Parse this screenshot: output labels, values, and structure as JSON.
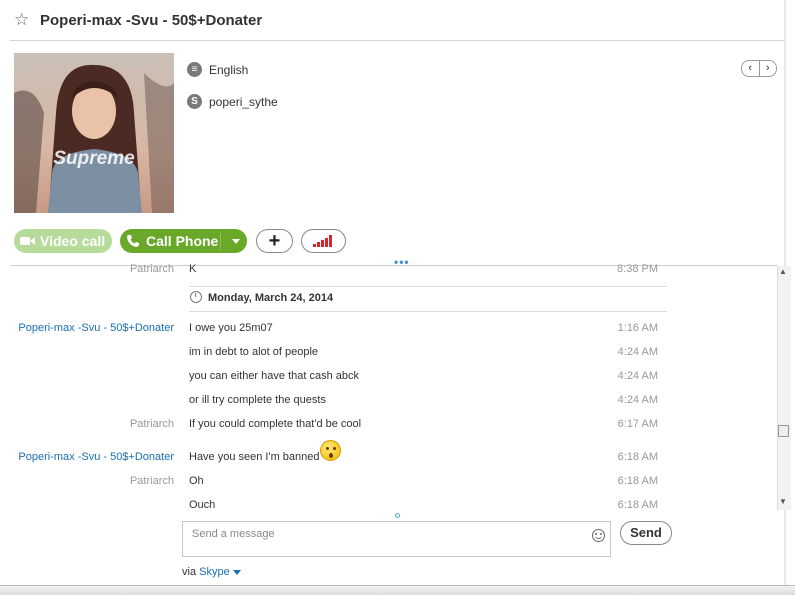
{
  "contact": {
    "name": "Poperi-max -Svu - 50$+Donater",
    "language": "English",
    "skype_name": "poperi_sythe",
    "avatar_text": "Supreme"
  },
  "icons": {
    "favorite": "star-icon",
    "language": "speech-bubble-icon",
    "skype": "skype-icon",
    "video": "video-camera-icon",
    "phone": "phone-icon",
    "add": "plus-icon",
    "signal": "signal-bars-icon",
    "date": "clock-icon",
    "emoticon": "smiley-icon"
  },
  "buttons": {
    "video_call": "Video call",
    "call_phone": "Call Phone",
    "add": "+",
    "send": "Send"
  },
  "nav": {
    "prev": "‹",
    "next": "›"
  },
  "conversation": {
    "first": {
      "sender": "Patriarch",
      "text": "K",
      "time": "8:38 PM"
    },
    "date_separator": "Monday, March 24, 2014",
    "messages": [
      {
        "sender": "Poperi-max -Svu - 50$+Donater",
        "text": "I owe you 25m07",
        "time": "1:16 AM"
      },
      {
        "sender": "",
        "text": "im in debt to alot of people",
        "time": "4:24 AM"
      },
      {
        "sender": "",
        "text": "you can either have that cash abck",
        "time": "4:24 AM"
      },
      {
        "sender": "",
        "text": "or ill try complete the quests",
        "time": "4:24 AM"
      },
      {
        "sender": "Patriarch",
        "text": "If you could complete that'd be cool",
        "time": "6:17 AM"
      },
      {
        "sender": "Poperi-max -Svu - 50$+Donater",
        "text": "Have you seen I'm banned",
        "time": "6:18 AM"
      },
      {
        "sender": "Patriarch",
        "text": "Oh",
        "time": "6:18 AM"
      },
      {
        "sender": "",
        "text": "Ouch",
        "time": "6:18 AM"
      }
    ]
  },
  "composer": {
    "placeholder": "Send a message",
    "value": ""
  },
  "footer": {
    "via_label": "via",
    "via_link": "Skype"
  },
  "colors": {
    "accent_green": "#6aa82a",
    "disabled_green": "#b7db9a",
    "link_blue": "#1a6fb5",
    "signal_red": "#d9262b"
  }
}
